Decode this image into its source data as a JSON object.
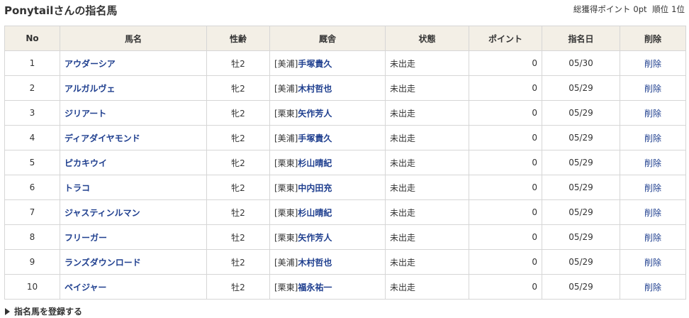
{
  "header": {
    "title": "Ponytailさんの指名馬",
    "total_points_label": "総獲得ポイント",
    "total_points": "0pt",
    "rank_label": "順位",
    "rank": "1位"
  },
  "table": {
    "columns": [
      "No",
      "馬名",
      "性齢",
      "厩舎",
      "状態",
      "ポイント",
      "指名日",
      "削除"
    ],
    "rows": [
      {
        "no": "1",
        "name": "アウダーシア",
        "sex_age": "牡2",
        "stable_loc": "[美浦]",
        "trainer": "手塚貴久",
        "status": "未出走",
        "points": "0",
        "date": "05/30",
        "delete": "削除"
      },
      {
        "no": "2",
        "name": "アルガルヴェ",
        "sex_age": "牝2",
        "stable_loc": "[美浦]",
        "trainer": "木村哲也",
        "status": "未出走",
        "points": "0",
        "date": "05/29",
        "delete": "削除"
      },
      {
        "no": "3",
        "name": "ジリアート",
        "sex_age": "牝2",
        "stable_loc": "[栗東]",
        "trainer": "矢作芳人",
        "status": "未出走",
        "points": "0",
        "date": "05/29",
        "delete": "削除"
      },
      {
        "no": "4",
        "name": "ディアダイヤモンド",
        "sex_age": "牝2",
        "stable_loc": "[美浦]",
        "trainer": "手塚貴久",
        "status": "未出走",
        "points": "0",
        "date": "05/29",
        "delete": "削除"
      },
      {
        "no": "5",
        "name": "ピカキウイ",
        "sex_age": "牝2",
        "stable_loc": "[栗東]",
        "trainer": "杉山晴紀",
        "status": "未出走",
        "points": "0",
        "date": "05/29",
        "delete": "削除"
      },
      {
        "no": "6",
        "name": "トラコ",
        "sex_age": "牝2",
        "stable_loc": "[栗東]",
        "trainer": "中内田充",
        "status": "未出走",
        "points": "0",
        "date": "05/29",
        "delete": "削除"
      },
      {
        "no": "7",
        "name": "ジャスティンルマン",
        "sex_age": "牡2",
        "stable_loc": "[栗東]",
        "trainer": "杉山晴紀",
        "status": "未出走",
        "points": "0",
        "date": "05/29",
        "delete": "削除"
      },
      {
        "no": "8",
        "name": "フリーガー",
        "sex_age": "牡2",
        "stable_loc": "[栗東]",
        "trainer": "矢作芳人",
        "status": "未出走",
        "points": "0",
        "date": "05/29",
        "delete": "削除"
      },
      {
        "no": "9",
        "name": "ランズダウンロード",
        "sex_age": "牡2",
        "stable_loc": "[美浦]",
        "trainer": "木村哲也",
        "status": "未出走",
        "points": "0",
        "date": "05/29",
        "delete": "削除"
      },
      {
        "no": "10",
        "name": "ペイジャー",
        "sex_age": "牡2",
        "stable_loc": "[栗東]",
        "trainer": "福永祐一",
        "status": "未出走",
        "points": "0",
        "date": "05/29",
        "delete": "削除"
      }
    ]
  },
  "footer": {
    "register_label": "指名馬を登録する"
  },
  "colors": {
    "header_bg": "#f3efe6",
    "link": "#1f3f8f",
    "border": "#d6d6d6"
  },
  "icons": {
    "register": "triangle-right-icon"
  }
}
